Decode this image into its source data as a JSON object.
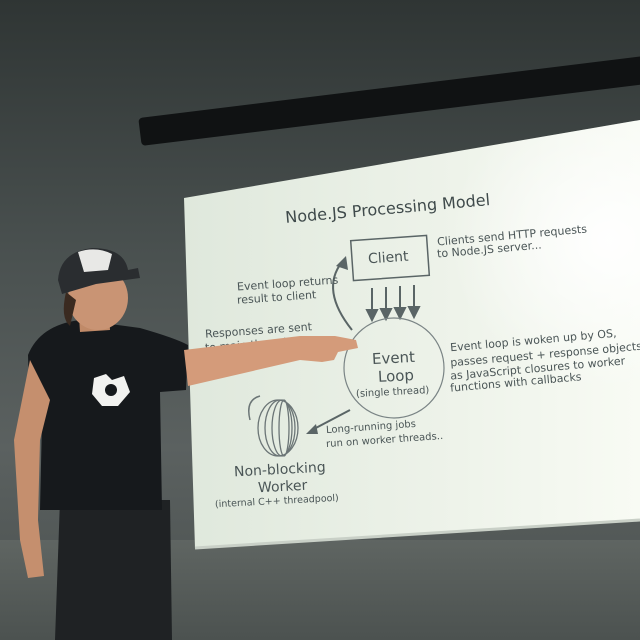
{
  "slide": {
    "title": "Node.JS Processing Model",
    "client_box": "Client",
    "client_note_1": "Clients send HTTP requests",
    "client_note_2": "to Node.JS server...",
    "return_note_1": "Event loop returns",
    "return_note_2": "result to client",
    "responses_note_1": "Responses are sent",
    "responses_note_2": "to main thread via",
    "event_loop_1": "Event",
    "event_loop_2": "Loop",
    "event_loop_3": "(single thread)",
    "woken_note_1": "Event loop is woken up by OS,",
    "woken_note_2": "passes request + response objects",
    "woken_note_3": "as JavaScript closures to worker",
    "woken_note_4": "functions with callbacks",
    "jobs_note_1": "Long-running jobs",
    "jobs_note_2": "run on worker threads..",
    "worker_1": "Non-blocking",
    "worker_2": "Worker",
    "worker_3": "(internal C++ threadpool)"
  },
  "colors": {
    "slide_bg": "#e9f0e6",
    "slide_text": "#4a5556",
    "shirt": "#16191c"
  }
}
